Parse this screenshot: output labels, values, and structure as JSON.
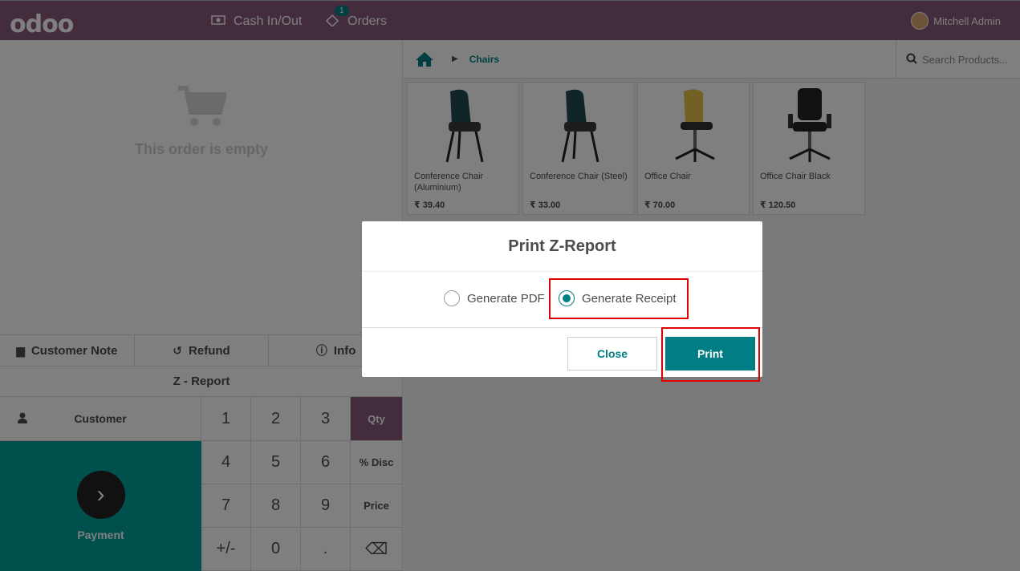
{
  "navbar": {
    "logo": "odoo",
    "cash_label": "Cash In/Out",
    "orders_label": "Orders",
    "orders_badge": "1",
    "user_name": "Mitchell Admin"
  },
  "order": {
    "empty_text": "This order is empty"
  },
  "controls": {
    "customer_note": "Customer Note",
    "refund": "Refund",
    "info": "Info",
    "z_report": "Z - Report",
    "customer": "Customer",
    "payment": "Payment"
  },
  "numpad": {
    "keys": [
      "1",
      "2",
      "3",
      "Qty",
      "4",
      "5",
      "6",
      "% Disc",
      "7",
      "8",
      "9",
      "Price",
      "+/-",
      "0",
      ".",
      "⌫"
    ]
  },
  "breadcrumb": {
    "category": "Chairs"
  },
  "search": {
    "placeholder": "Search Products..."
  },
  "products": [
    {
      "name": "Conference Chair (Aluminium)",
      "price": "₹ 39.40",
      "seat_color": "#1f4a4c"
    },
    {
      "name": "Conference Chair (Steel)",
      "price": "₹ 33.00",
      "seat_color": "#1f4a4c"
    },
    {
      "name": "Office Chair",
      "price": "₹ 70.00",
      "seat_color": "#e4c04a"
    },
    {
      "name": "Office Chair Black",
      "price": "₹ 120.50",
      "seat_color": "#222222"
    }
  ],
  "dialog": {
    "title": "Print Z-Report",
    "option_pdf": "Generate PDF",
    "option_receipt": "Generate Receipt",
    "selected": "receipt",
    "close_label": "Close",
    "print_label": "Print"
  },
  "colors": {
    "brand": "#875a7b",
    "accent": "#017e84",
    "payment": "#00a09d",
    "highlight": "#e00000"
  }
}
